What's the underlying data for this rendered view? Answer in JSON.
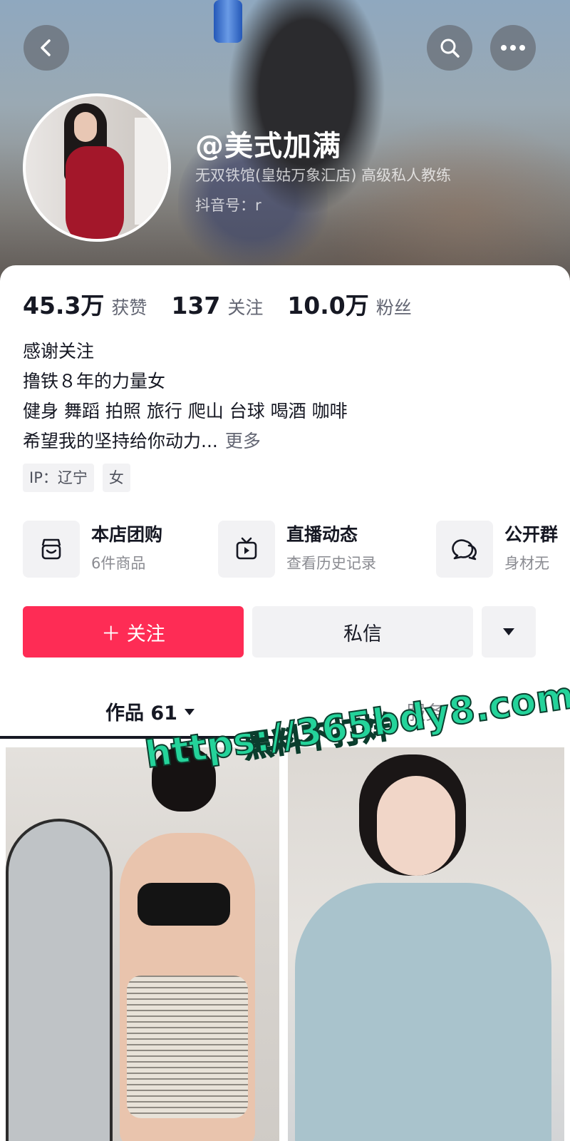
{
  "header": {
    "nickname": "@美式加满",
    "work_info": "无双铁馆(皇姑万象汇店) 高级私人教练",
    "douyin_id": "抖音号：r"
  },
  "stats": [
    {
      "num": "45.3万",
      "label": "获赞"
    },
    {
      "num": "137",
      "label": "关注"
    },
    {
      "num": "10.0万",
      "label": "粉丝"
    }
  ],
  "bio": {
    "lines": [
      "感谢关注",
      "撸铁８年的力量女",
      "健身 舞蹈 拍照 旅行 爬山 台球 喝酒 咖啡",
      "希望我的坚持给你动力..."
    ],
    "more": "更多"
  },
  "tags": [
    "IP：辽宁",
    "女"
  ],
  "entries": [
    {
      "title": "本店团购",
      "sub": "6件商品",
      "icon": "store-bag-icon"
    },
    {
      "title": "直播动态",
      "sub": "查看历史记录",
      "icon": "tv-icon"
    },
    {
      "title": "公开群",
      "sub": "身材无",
      "icon": "chat-bubbles-icon"
    }
  ],
  "actions": {
    "follow": "＋ 关注",
    "message": "私信"
  },
  "tabs": {
    "works_label": "作品 61",
    "service_label": "服务"
  },
  "overlay": {
    "line1": "黑料不打烊",
    "line2": "https://365bdy8.com"
  },
  "colors": {
    "accent": "#fe2c55",
    "overlay_text": "#24d39a"
  }
}
